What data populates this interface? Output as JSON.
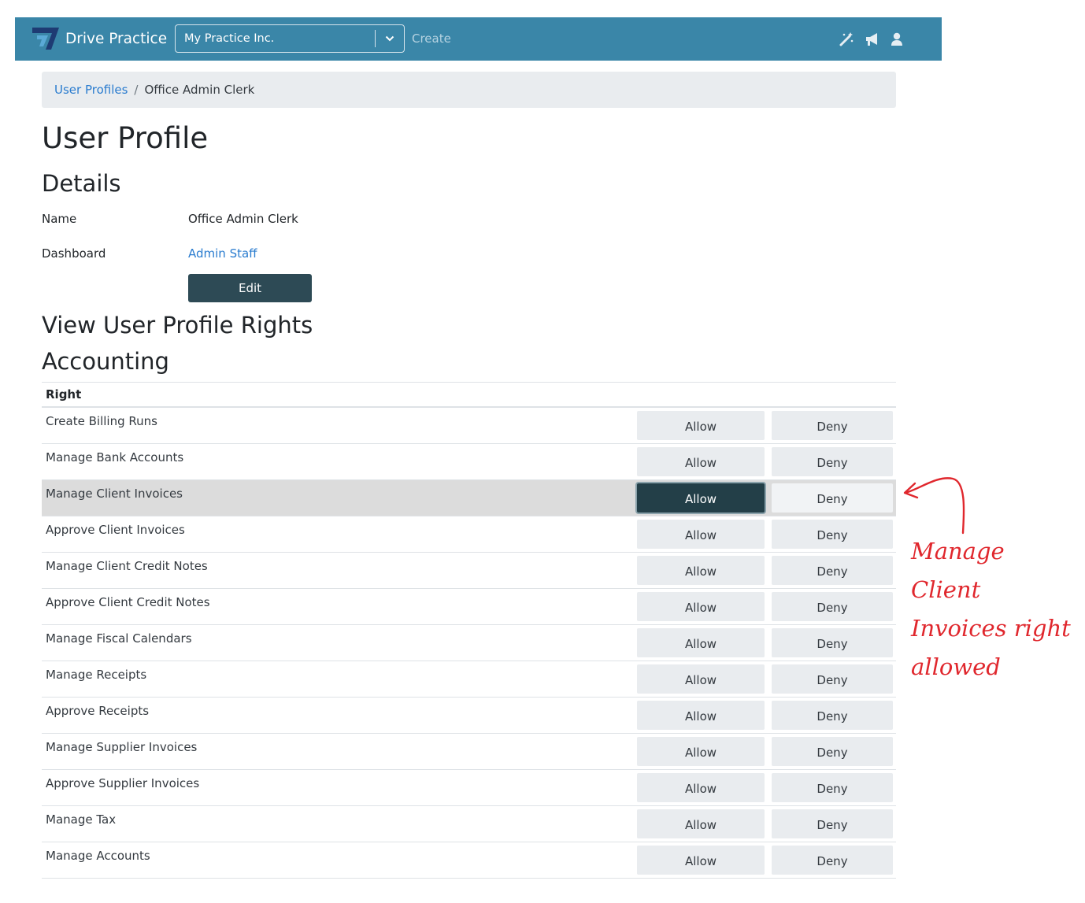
{
  "navbar": {
    "brand": "Drive Practice",
    "practice_select": "My Practice Inc.",
    "create_label": "Create",
    "bg_color": "#3a86a8",
    "icons": [
      "magic-wand-icon",
      "megaphone-icon",
      "user-icon"
    ]
  },
  "breadcrumb": {
    "parent": "User Profiles",
    "separator": "/",
    "current": "Office Admin Clerk"
  },
  "page": {
    "title": "User Profile",
    "details_heading": "Details",
    "name_label": "Name",
    "name_value": "Office Admin Clerk",
    "dashboard_label": "Dashboard",
    "dashboard_value": "Admin Staff",
    "edit_label": "Edit",
    "rights_heading": "View User Profile Rights",
    "section_heading": "Accounting"
  },
  "table": {
    "header": "Right",
    "allow_label": "Allow",
    "deny_label": "Deny",
    "rows": [
      {
        "label": "Create Billing Runs",
        "state": "none"
      },
      {
        "label": "Manage Bank Accounts",
        "state": "none"
      },
      {
        "label": "Manage Client Invoices",
        "state": "allow"
      },
      {
        "label": "Approve Client Invoices",
        "state": "none"
      },
      {
        "label": "Manage Client Credit Notes",
        "state": "none"
      },
      {
        "label": "Approve Client Credit Notes",
        "state": "none"
      },
      {
        "label": "Manage Fiscal Calendars",
        "state": "none"
      },
      {
        "label": "Manage Receipts",
        "state": "none"
      },
      {
        "label": "Approve Receipts",
        "state": "none"
      },
      {
        "label": "Manage Supplier Invoices",
        "state": "none"
      },
      {
        "label": "Approve Supplier Invoices",
        "state": "none"
      },
      {
        "label": "Manage Tax",
        "state": "none"
      },
      {
        "label": "Manage Accounts",
        "state": "none"
      }
    ]
  },
  "annotation": {
    "lines": [
      "Manage",
      "Client",
      "Invoices right",
      "allowed"
    ],
    "color": "#e0272d"
  }
}
